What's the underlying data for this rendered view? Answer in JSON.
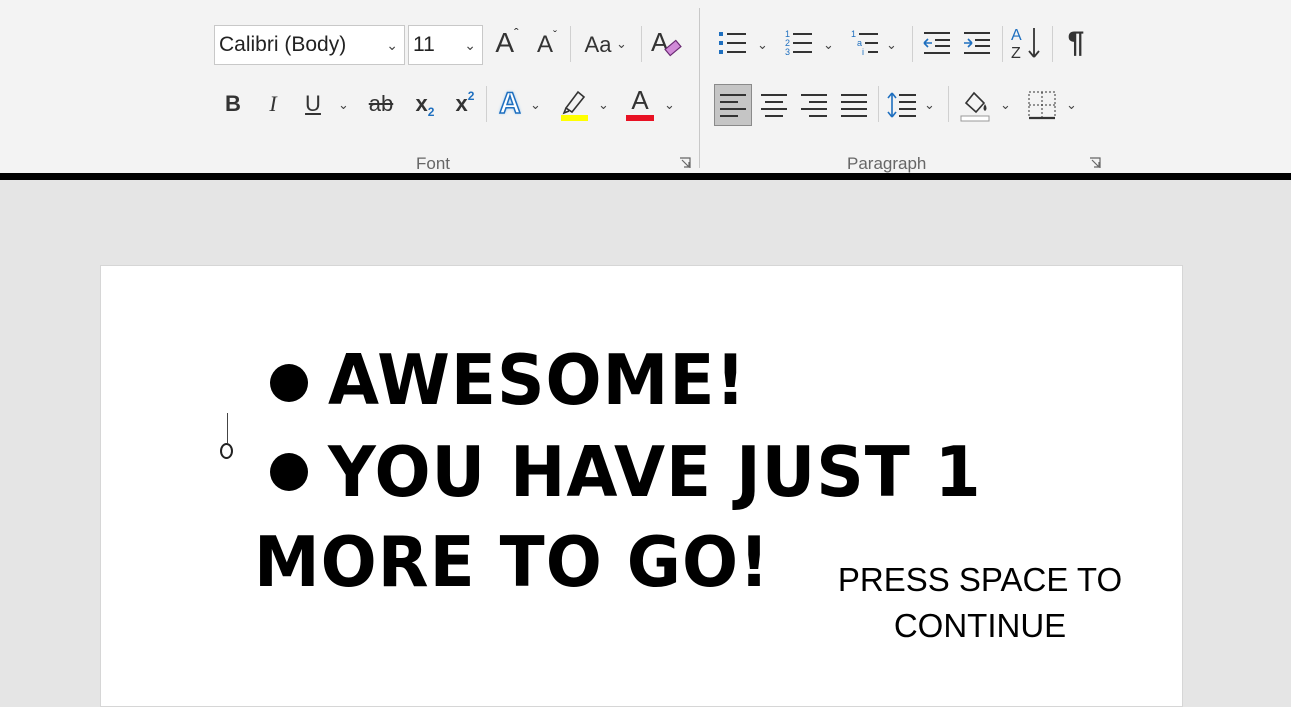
{
  "font_group": {
    "font_name": "Calibri (Body)",
    "font_size": "11",
    "change_case_label": "Aa",
    "grow_font_icon": "A",
    "shrink_font_icon": "A",
    "bold": "B",
    "italic": "I",
    "underline": "U",
    "strike": "ab",
    "subscript": "x",
    "subscript_mark": "2",
    "superscript": "x",
    "superscript_mark": "2",
    "text_effects": "A",
    "font_color": "A",
    "label": "Font",
    "highlight_color": "#ffff00",
    "font_color_value": "#e81123"
  },
  "paragraph_group": {
    "label": "Paragraph",
    "sort_icon": "sort-az-icon",
    "pilcrow": "¶"
  },
  "document": {
    "bullet_1": "AWESOME!",
    "bullet_2": "YOU HAVE JUST 1",
    "continuation": "MORE TO GO!",
    "press_line_1": "PRESS SPACE TO",
    "press_line_2": "CONTINUE"
  }
}
